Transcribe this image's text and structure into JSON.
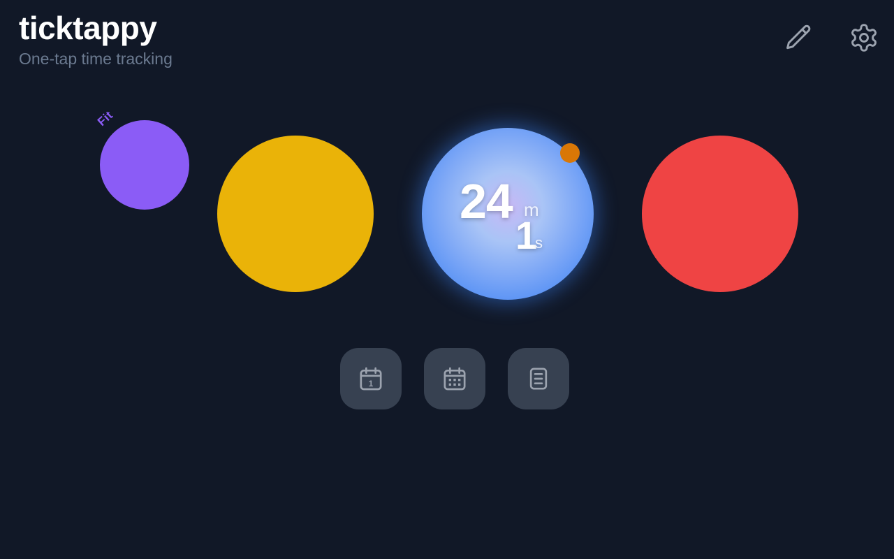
{
  "app": {
    "title": "ticktappy",
    "subtitle": "One-tap time tracking"
  },
  "toolbar": {
    "edit_icon": "pencil-icon",
    "settings_icon": "gear-icon"
  },
  "bubbles": [
    {
      "label": "Fit",
      "color": "#8b5cf6"
    },
    {
      "label": "",
      "color": "#eab308"
    },
    {
      "label": "",
      "color": "#3b82f6",
      "active": true
    },
    {
      "label": "",
      "color": "#ef4444"
    }
  ],
  "timer": {
    "minutes": "24",
    "minutes_unit": "m",
    "seconds": "1",
    "seconds_unit": "s"
  },
  "status_dot_color": "#d97706",
  "bottom_nav": [
    {
      "icon": "calendar-day-icon",
      "day_number": "1"
    },
    {
      "icon": "calendar-month-icon"
    },
    {
      "icon": "report-icon"
    }
  ]
}
